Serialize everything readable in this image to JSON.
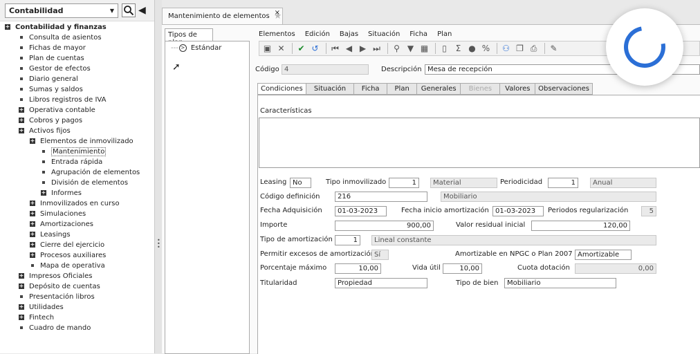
{
  "nav": {
    "module": "Contabilidad",
    "tree": [
      {
        "label": "Contabilidad y finanzas",
        "marker": "plus",
        "bold": true
      },
      {
        "label": "Consulta de asientos",
        "marker": "dot"
      },
      {
        "label": "Fichas de mayor",
        "marker": "dot"
      },
      {
        "label": "Plan de cuentas",
        "marker": "dot"
      },
      {
        "label": "Gestor de efectos",
        "marker": "dot"
      },
      {
        "label": "Diario general",
        "marker": "dot"
      },
      {
        "label": "Sumas y saldos",
        "marker": "dot"
      },
      {
        "label": "Libros registros de IVA",
        "marker": "dot"
      },
      {
        "label": "Operativa contable",
        "marker": "plus"
      },
      {
        "label": "Cobros y pagos",
        "marker": "plus"
      },
      {
        "label": "Activos fijos",
        "marker": "plus"
      },
      {
        "label": "Elementos de inmovilizado",
        "marker": "plus"
      },
      {
        "label": "Mantenimiento",
        "marker": "dot",
        "selected": true
      },
      {
        "label": "Entrada rápida",
        "marker": "dot"
      },
      {
        "label": "Agrupación de elementos",
        "marker": "dot"
      },
      {
        "label": "División de elementos",
        "marker": "dot"
      },
      {
        "label": "Informes",
        "marker": "plus"
      },
      {
        "label": "Inmovilizados en curso",
        "marker": "plus"
      },
      {
        "label": "Simulaciones",
        "marker": "plus"
      },
      {
        "label": "Amortizaciones",
        "marker": "plus"
      },
      {
        "label": "Leasings",
        "marker": "plus"
      },
      {
        "label": "Cierre del ejercicio",
        "marker": "plus"
      },
      {
        "label": "Procesos auxiliares",
        "marker": "plus"
      },
      {
        "label": "Mapa de operativa",
        "marker": "dot"
      },
      {
        "label": "Impresos Oficiales",
        "marker": "plus"
      },
      {
        "label": "Depósito de cuentas",
        "marker": "plus"
      },
      {
        "label": "Presentación libros",
        "marker": "dot"
      },
      {
        "label": "Utilidades",
        "marker": "plus"
      },
      {
        "label": "Fintech",
        "marker": "plus"
      },
      {
        "label": "Cuadro de mando",
        "marker": "dot"
      }
    ]
  },
  "doc_tab": {
    "title": "Mantenimiento de elementos",
    "close": "×"
  },
  "plans": {
    "header": "Tipos de plan",
    "item": "Estándar"
  },
  "menu": [
    "Elementos",
    "Edición",
    "Bajas",
    "Situación",
    "Ficha",
    "Plan"
  ],
  "toolbar_icons": [
    "new-icon",
    "delete-icon",
    "accept-icon",
    "undo-icon",
    "first-icon",
    "previous-icon",
    "next-icon",
    "last-icon",
    "search-icon",
    "filter-icon",
    "grid-icon",
    "document-icon",
    "sum-icon",
    "record-icon",
    "percent-icon",
    "tree-icon",
    "copy-icon",
    "export-icon",
    "edit-icon"
  ],
  "header": {
    "code_label": "Código",
    "code_value": "4",
    "desc_label": "Descripción",
    "desc_value": "Mesa de recepción"
  },
  "tabs": [
    "Condiciones",
    "Situación",
    "Ficha",
    "Plan",
    "Generales",
    "Bienes",
    "Valores",
    "Observaciones"
  ],
  "form": {
    "caracteristicas": "Características",
    "leasing": {
      "label": "Leasing",
      "value": "No"
    },
    "tipo_inmov": {
      "label": "Tipo inmovilizado",
      "value": "1",
      "desc": "Material"
    },
    "periodicidad": {
      "label": "Periodicidad",
      "value": "1",
      "desc": "Anual"
    },
    "codigo_def": {
      "label": "Código definición",
      "value": "216",
      "desc": "Mobiliario"
    },
    "fecha_adq": {
      "label": "Fecha Adquisición",
      "value": "01-03-2023"
    },
    "fecha_ini": {
      "label": "Fecha inicio amortización",
      "value": "01-03-2023"
    },
    "periodos": {
      "label": "Periodos regularización",
      "value": "5"
    },
    "importe": {
      "label": "Importe",
      "value": "900,00"
    },
    "residual": {
      "label": "Valor residual inicial",
      "value": "120,00"
    },
    "tipo_amort": {
      "label": "Tipo de amortización",
      "value": "1",
      "desc": "Lineal constante"
    },
    "excesos": {
      "label": "Permitir excesos de amortización",
      "value": "Sí"
    },
    "npgc": {
      "label": "Amortizable en NPGC o Plan 2007",
      "value": "Amortizable"
    },
    "porcentaje": {
      "label": "Porcentaje máximo",
      "value": "10,00"
    },
    "vida": {
      "label": "Vida útil",
      "value": "10,00"
    },
    "cuota": {
      "label": "Cuota dotación",
      "value": "0,00"
    },
    "titularidad": {
      "label": "Titularidad",
      "value": "Propiedad"
    },
    "tipo_bien": {
      "label": "Tipo de bien",
      "value": "Mobiliario"
    }
  },
  "colors": {
    "spinner": "#2b6fd6"
  }
}
